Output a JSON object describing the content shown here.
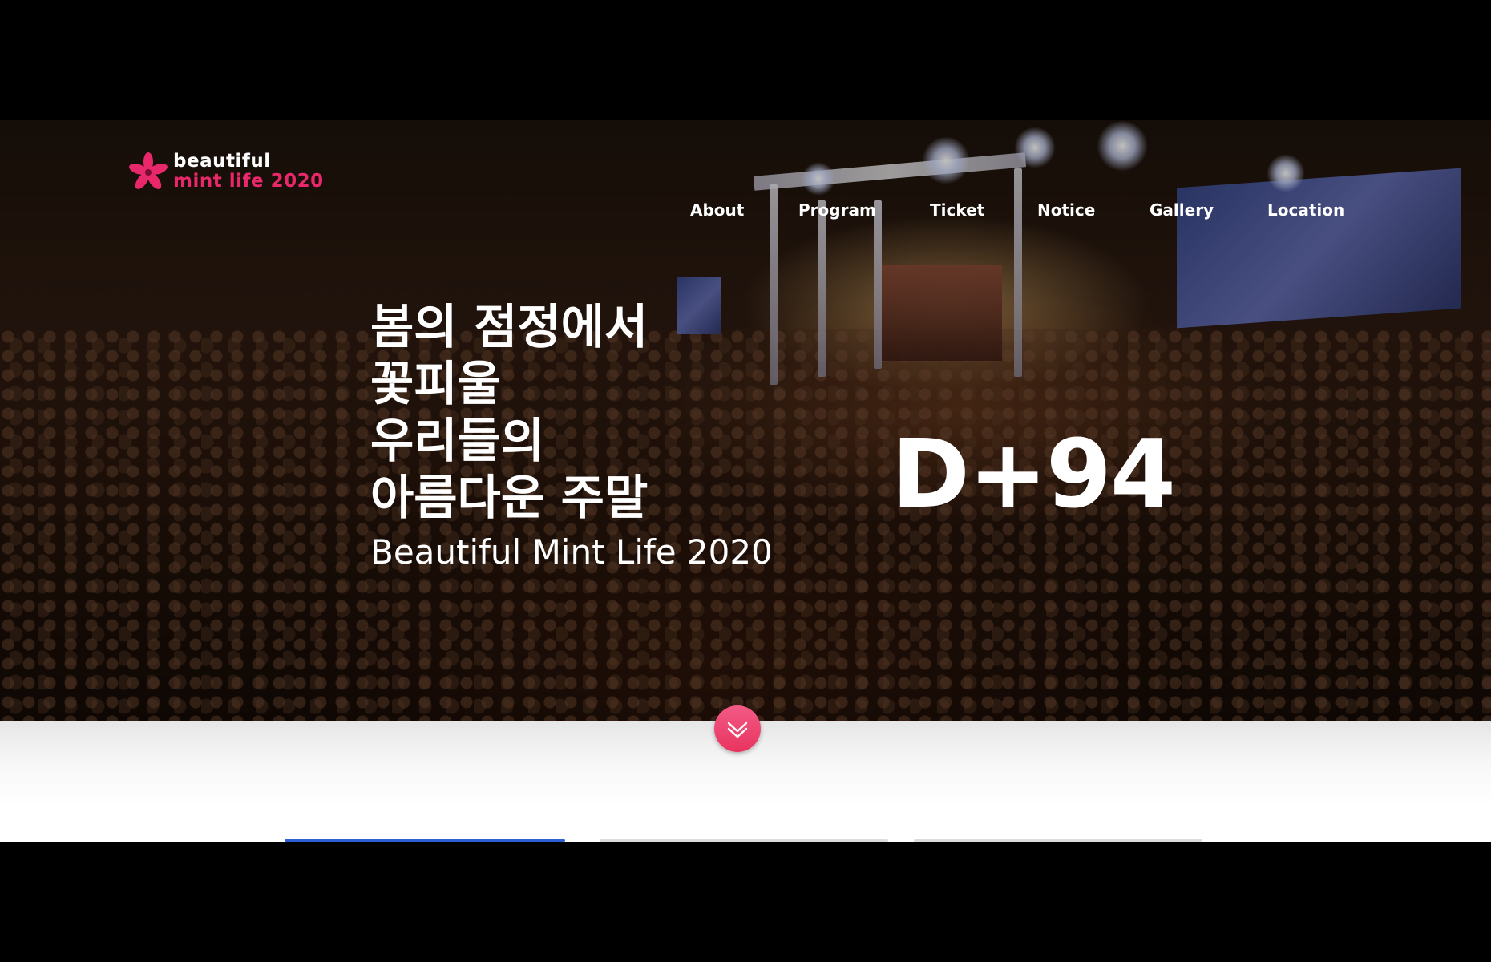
{
  "logo": {
    "line1": "beautiful",
    "line2": "mint life 2020",
    "accent_color": "#e8286a",
    "icon": "flower-icon"
  },
  "nav": {
    "items": [
      {
        "label": "About"
      },
      {
        "label": "Program"
      },
      {
        "label": "Ticket"
      },
      {
        "label": "Notice"
      },
      {
        "label": "Gallery"
      },
      {
        "label": "Location"
      }
    ]
  },
  "hero": {
    "headline_lines": [
      "봄의 점정에서",
      "꽃피울",
      "우리들의",
      "아름다운 주말"
    ],
    "subtitle": "Beautiful Mint Life 2020",
    "dday": "D+94"
  },
  "scroll_button": {
    "icon": "double-chevron-down-icon",
    "color": "#ef4670"
  }
}
